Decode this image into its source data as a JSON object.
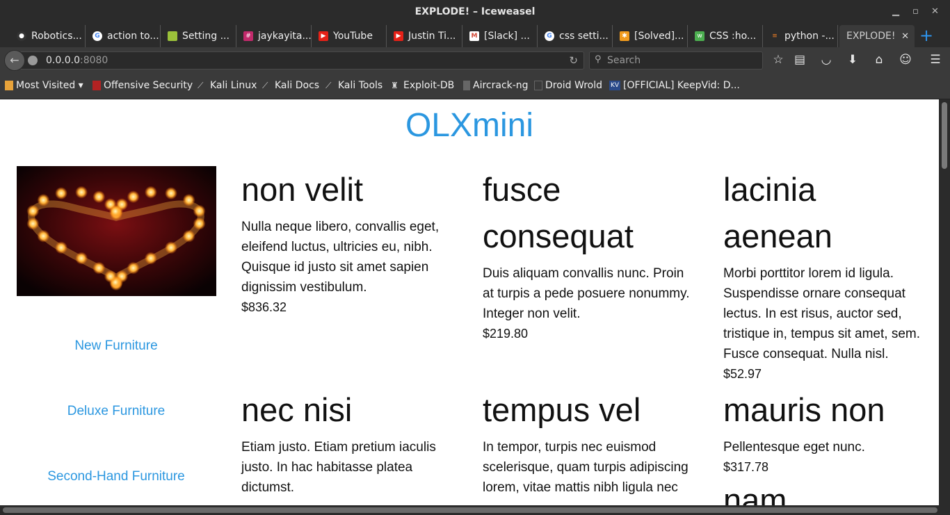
{
  "window": {
    "title": "EXPLODE! – Iceweasel"
  },
  "tabs": [
    {
      "label": "Robotics...",
      "icon": "github-icon",
      "color": "#333333"
    },
    {
      "label": "action to...",
      "icon": "google-icon",
      "color": "#ffffff"
    },
    {
      "label": "Setting ...",
      "icon": "android-icon",
      "color": "#9bc13a"
    },
    {
      "label": "jaykayita...",
      "icon": "slack-icon",
      "color": "#c12a6b"
    },
    {
      "label": "YouTube",
      "icon": "youtube-icon",
      "color": "#e62117"
    },
    {
      "label": "Justin Ti...",
      "icon": "youtube-icon",
      "color": "#e62117"
    },
    {
      "label": "[Slack] ...",
      "icon": "gmail-icon",
      "color": "#d14836"
    },
    {
      "label": "css setti...",
      "icon": "google-icon",
      "color": "#ffffff"
    },
    {
      "label": "[Solved]...",
      "icon": "puzzle-icon",
      "color": "#f29b1d"
    },
    {
      "label": "CSS :ho...",
      "icon": "w3schools-icon",
      "color": "#4caf50"
    },
    {
      "label": "python -...",
      "icon": "stackoverflow-icon",
      "color": "#f48024"
    },
    {
      "label": "EXPLODE!",
      "active": true
    }
  ],
  "navbar": {
    "url_host": "0.0.0.0",
    "url_port": ":8080",
    "search_placeholder": "Search"
  },
  "bookmarks": [
    {
      "label": "Most Visited ▾",
      "icon": "folder-icon",
      "color": "#e8a33a"
    },
    {
      "label": "Offensive Security",
      "icon": "offsec-icon",
      "color": "#b32222"
    },
    {
      "label": "Kali Linux",
      "icon": "kali-icon",
      "color": "#cccccc"
    },
    {
      "label": "Kali Docs",
      "icon": "kali-icon",
      "color": "#cccccc"
    },
    {
      "label": "Kali Tools",
      "icon": "kali-icon",
      "color": "#cccccc"
    },
    {
      "label": "Exploit-DB",
      "icon": "exploitdb-icon",
      "color": "#dddddd"
    },
    {
      "label": "Aircrack-ng",
      "icon": "aircrack-icon",
      "color": "#888888"
    },
    {
      "label": "Droid Wrold",
      "icon": "page-icon",
      "color": "#555555"
    },
    {
      "label": "[OFFICIAL] KeepVid: D...",
      "icon": "keepvid-icon",
      "color": "#2a4a8a"
    }
  ],
  "page": {
    "brand": "OLXmini",
    "categories": [
      "New Furniture",
      "Deluxe Furniture",
      "Second-Hand Furniture"
    ],
    "products": [
      {
        "title": "non velit",
        "desc": "Nulla neque libero, convallis eget, eleifend luctus, ultricies eu, nibh. Quisque id justo sit amet sapien dignissim vestibulum.",
        "price": "$836.32"
      },
      {
        "title": "fusce consequat",
        "desc": "Duis aliquam convallis nunc. Proin at turpis a pede posuere nonummy. Integer non velit.",
        "price": "$219.80"
      },
      {
        "title": "lacinia aenean",
        "desc": "Morbi porttitor lorem id ligula. Suspendisse ornare consequat lectus. In est risus, auctor sed, tristique in, tempus sit amet, sem. Fusce consequat. Nulla nisl.",
        "price": "$52.97"
      },
      {
        "title": "nec nisi",
        "desc": "Etiam justo. Etiam pretium iaculis justo. In hac habitasse platea dictumst.",
        "price": ""
      },
      {
        "title": "tempus vel",
        "desc": "In tempor, turpis nec euismod scelerisque, quam turpis adipiscing lorem, vitae mattis nibh ligula nec",
        "price": ""
      },
      {
        "title": "mauris non",
        "desc": "Pellentesque eget nunc.",
        "price": "$317.78"
      },
      {
        "title": "nam",
        "desc": "",
        "price": ""
      }
    ]
  }
}
